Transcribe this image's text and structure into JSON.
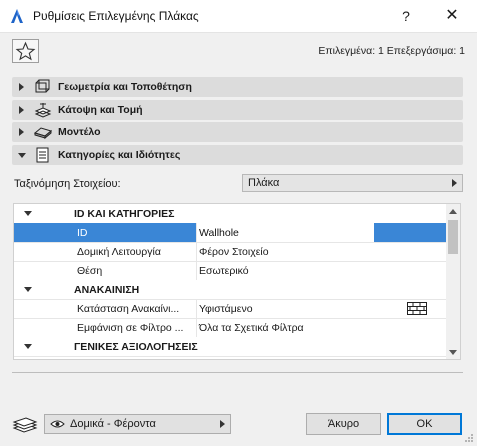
{
  "window": {
    "title": "Ρυθμίσεις Επιλεγμένης Πλάκας",
    "help_label": "?",
    "close_label": "✕"
  },
  "toolbar": {
    "favorite_icon": "star-icon",
    "selection_status": "Επιλεγμένα: 1 Επεξεργάσιμα: 1"
  },
  "panels": [
    {
      "label": "Γεωμετρία και Τοποθέτηση",
      "icon": "geometry-icon",
      "expanded": false
    },
    {
      "label": "Κάτοψη και Τομή",
      "icon": "floorplan-icon",
      "expanded": false
    },
    {
      "label": "Μοντέλο",
      "icon": "model-icon",
      "expanded": false
    },
    {
      "label": "Κατηγορίες και Ιδιότητες",
      "icon": "properties-icon",
      "expanded": true
    }
  ],
  "classification": {
    "label": "Ταξινόμηση Στοιχείου:",
    "value": "Πλάκα"
  },
  "table": {
    "sections": [
      {
        "title": "ID ΚΑΙ ΚΑΤΗΓΟΡΙΕΣ",
        "rows": [
          {
            "name": "ID",
            "value": "Wallhole",
            "selected": true
          },
          {
            "name": "Δομική Λειτουργία",
            "value": "Φέρον Στοιχείο"
          },
          {
            "name": "Θέση",
            "value": "Εσωτερικό"
          }
        ]
      },
      {
        "title": "ΑΝΑΚΑΙΝΙΣΗ",
        "rows": [
          {
            "name": "Κατάσταση Ανακαίνι...",
            "value": "Υφιστάμενο",
            "icon": "brick-wall-icon"
          },
          {
            "name": "Εμφάνιση σε Φίλτρο ...",
            "value": "Όλα τα Σχετικά Φίλτρα"
          }
        ]
      },
      {
        "title": "ΓΕΝΙΚΕΣ ΑΞΙΟΛΟΓΗΣΕΙΣ",
        "rows": []
      }
    ]
  },
  "footer": {
    "layer_icon": "layers-icon",
    "view_icon": "eye-icon",
    "view_value": "Δομικά - Φέροντα",
    "cancel_label": "Άκυρο",
    "ok_label": "OK"
  },
  "colors": {
    "selection": "#3a86d6",
    "panel": "#dcdcdc",
    "ok_border": "#0078d7"
  }
}
